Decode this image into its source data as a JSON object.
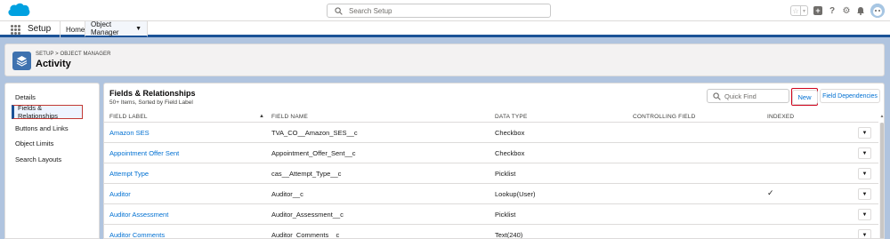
{
  "header": {
    "search_placeholder": "Search Setup",
    "logo_icon": "salesforce-cloud-icon",
    "icons": [
      "star-icon",
      "chevron-down-icon",
      "plus-icon",
      "help-icon",
      "gear-icon",
      "bell-icon",
      "avatar-icon"
    ]
  },
  "nav": {
    "app_name": "Setup",
    "tabs": [
      {
        "label": "Home"
      },
      {
        "label": "Object Manager"
      }
    ]
  },
  "page": {
    "breadcrumb": "SETUP > OBJECT MANAGER",
    "title": "Activity"
  },
  "sidebar": {
    "items": [
      {
        "label": "Details"
      },
      {
        "label": "Fields & Relationships",
        "active": true
      },
      {
        "label": "Buttons and Links"
      },
      {
        "label": "Object Limits"
      },
      {
        "label": "Search Layouts"
      }
    ]
  },
  "main": {
    "title": "Fields & Relationships",
    "subtitle": "50+ Items, Sorted by Field Label",
    "quick_find_placeholder": "Quick Find",
    "new_button": "New",
    "field_dependencies_button": "Field Dependencies",
    "columns": [
      "FIELD LABEL",
      "FIELD NAME",
      "DATA TYPE",
      "CONTROLLING FIELD",
      "INDEXED"
    ],
    "rows": [
      {
        "label": "Amazon SES",
        "name": "TVA_CO__Amazon_SES__c",
        "type": "Checkbox",
        "controlling": "",
        "indexed": ""
      },
      {
        "label": "Appointment Offer Sent",
        "name": "Appointment_Offer_Sent__c",
        "type": "Checkbox",
        "controlling": "",
        "indexed": ""
      },
      {
        "label": "Attempt Type",
        "name": "cas__Attempt_Type__c",
        "type": "Picklist",
        "controlling": "",
        "indexed": ""
      },
      {
        "label": "Auditor",
        "name": "Auditor__c",
        "type": "Lookup(User)",
        "controlling": "",
        "indexed": "✓"
      },
      {
        "label": "Auditor Assessment",
        "name": "Auditor_Assessment__c",
        "type": "Picklist",
        "controlling": "",
        "indexed": ""
      },
      {
        "label": "Auditor Comments",
        "name": "Auditor_Comments__c",
        "type": "Text(240)",
        "controlling": "",
        "indexed": ""
      }
    ]
  },
  "colors": {
    "brand_blue": "#1b5297",
    "link_blue": "#0070d2",
    "highlight_red": "#d0021b",
    "backdrop": "#b0c4df"
  }
}
